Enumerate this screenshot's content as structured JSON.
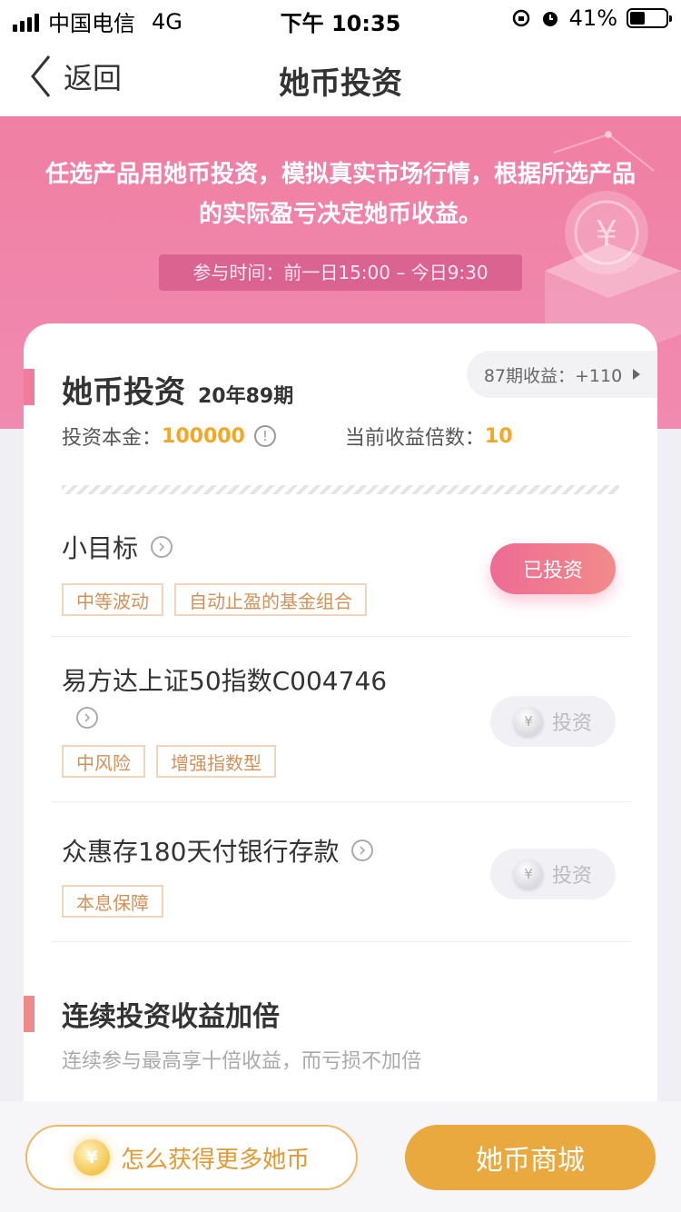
{
  "status_bar": {
    "carrier": "中国电信",
    "network": "4G",
    "time": "下午 10:35",
    "battery_pct": "41%",
    "battery_level": 0.41
  },
  "nav": {
    "back_label": "返回",
    "title": "她币投资"
  },
  "hero": {
    "description": "任选产品用她币投资，模拟真实市场行情，根据所选产品的实际盈亏决定她币收益。",
    "time_range": "参与时间：前一日15:00 – 今日9:30"
  },
  "card": {
    "title": "她币投资",
    "period": "20年89期",
    "prev_earnings": "87期收益：+110",
    "principal_label": "投资本金：",
    "principal_value": "100000",
    "multiplier_label": "当前收益倍数：",
    "multiplier_value": "10"
  },
  "products": [
    {
      "name": "小目标",
      "tags": [
        "中等波动",
        "自动止盈的基金组合"
      ],
      "button": "已投资",
      "invested": true
    },
    {
      "name": "易方达上证50指数C004746",
      "tags": [
        "中风险",
        "增强指数型"
      ],
      "button": "投资",
      "invested": false
    },
    {
      "name": "众惠存180天付银行存款",
      "tags": [
        "本息保障"
      ],
      "button": "投资",
      "invested": false
    }
  ],
  "section2": {
    "title": "连续投资收益加倍",
    "subtitle": "连续参与最高享十倍收益，而亏损不加倍"
  },
  "bottom": {
    "how_label": "怎么获得更多她币",
    "mall_label": "她币商城",
    "coin_symbol": "¥"
  },
  "colors": {
    "brand_pink": "#f07fa3",
    "accent_gold": "#e9a93f",
    "value_orange": "#f5a623"
  }
}
